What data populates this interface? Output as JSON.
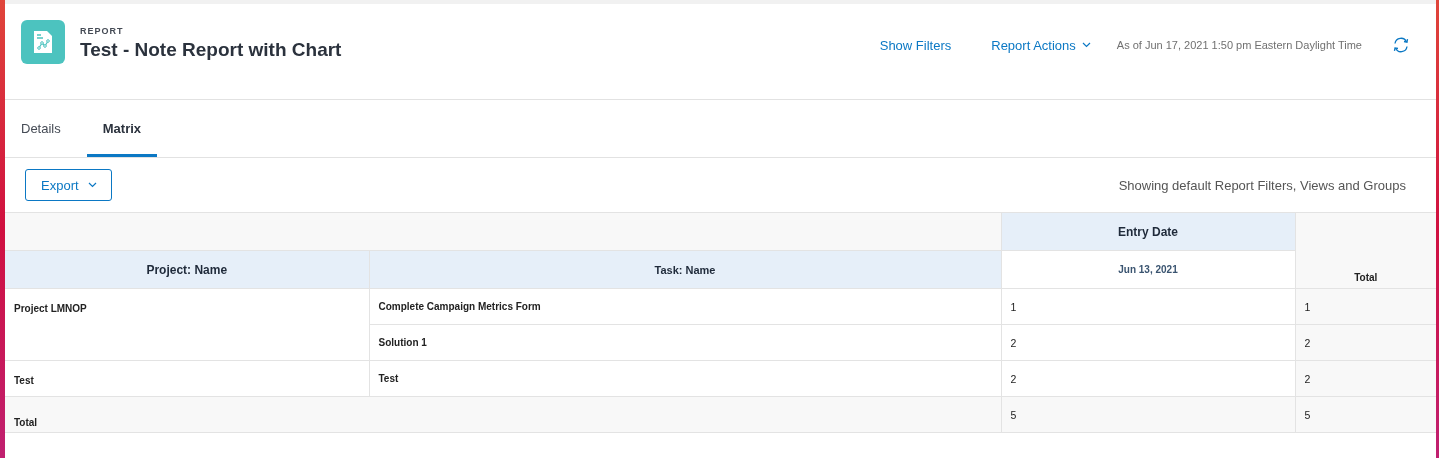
{
  "header": {
    "object_type": "REPORT",
    "title": "Test - Note Report with Chart",
    "show_filters": "Show Filters",
    "report_actions": "Report Actions",
    "timestamp": "As of Jun 17, 2021 1:50 pm Eastern Daylight Time"
  },
  "tabs": [
    {
      "label": "Details",
      "selected": false
    },
    {
      "label": "Matrix",
      "selected": true
    }
  ],
  "toolbar": {
    "export": "Export",
    "status": "Showing default Report Filters, Views and Groups"
  },
  "matrix": {
    "column_group": "Entry Date",
    "row_headers": [
      "Project: Name",
      "Task: Name"
    ],
    "columns": [
      "Jun 13, 2021"
    ],
    "total_header": "Total",
    "groups": [
      {
        "project": "Project LMNOP",
        "rows": [
          {
            "task": "Complete Campaign Metrics Form",
            "values": [
              "1"
            ],
            "total": "1"
          },
          {
            "task": "Solution 1",
            "values": [
              "2"
            ],
            "total": "2"
          }
        ]
      },
      {
        "project": "Test",
        "rows": [
          {
            "task": "Test",
            "values": [
              "2"
            ],
            "total": "2"
          }
        ]
      }
    ],
    "total_row": {
      "label": "Total",
      "values": [
        "5"
      ],
      "total": "5"
    }
  }
}
